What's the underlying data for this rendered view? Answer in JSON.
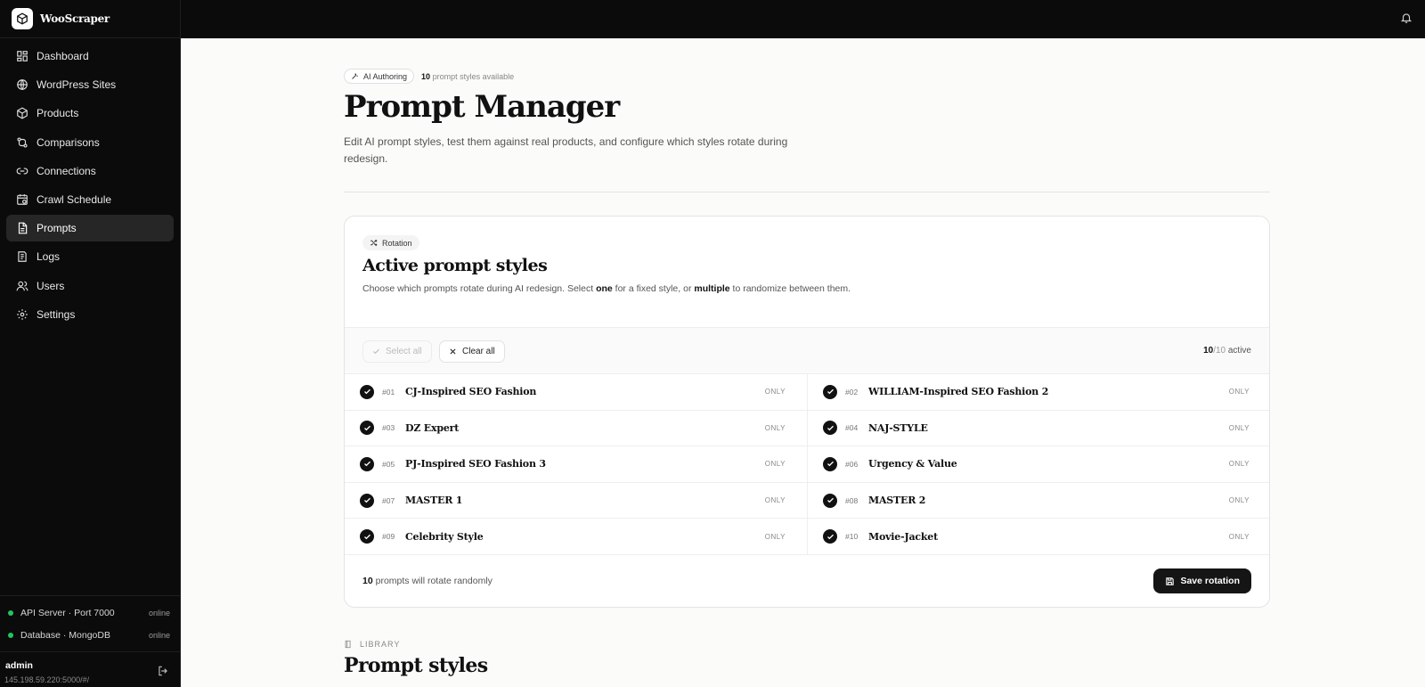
{
  "app": {
    "name": "WooScraper"
  },
  "sidebar": {
    "items": [
      {
        "label": "Dashboard",
        "icon": "grid-icon"
      },
      {
        "label": "WordPress Sites",
        "icon": "globe-icon"
      },
      {
        "label": "Products",
        "icon": "box-icon"
      },
      {
        "label": "Comparisons",
        "icon": "compare-icon"
      },
      {
        "label": "Connections",
        "icon": "link-icon"
      },
      {
        "label": "Crawl Schedule",
        "icon": "calendar-icon"
      },
      {
        "label": "Prompts",
        "icon": "document-icon",
        "active": true
      },
      {
        "label": "Logs",
        "icon": "logs-icon"
      },
      {
        "label": "Users",
        "icon": "users-icon"
      },
      {
        "label": "Settings",
        "icon": "gear-icon"
      }
    ],
    "status": [
      {
        "label": "API Server · Port 7000",
        "value": "online"
      },
      {
        "label": "Database · MongoDB",
        "value": "online"
      }
    ],
    "user": {
      "name": "admin",
      "url": "145.198.59.220:5000/#/"
    }
  },
  "header": {
    "chip": "AI Authoring",
    "count": "10",
    "count_suffix": "prompt styles available",
    "title": "Prompt Manager",
    "description": "Edit AI prompt styles, test them against real products, and configure which styles rotate during redesign."
  },
  "rotation": {
    "chip": "Rotation",
    "title": "Active prompt styles",
    "desc_1": "Choose which prompts rotate during AI redesign. Select ",
    "desc_one": "one",
    "desc_2": " for a fixed style, or ",
    "desc_multiple": "multiple",
    "desc_3": " to randomize between them.",
    "select_all": "Select all",
    "clear_all": "Clear all",
    "active_count": "10",
    "active_total": "/10",
    "active_suffix": "active",
    "only_label": "ONLY",
    "prompts": [
      {
        "num": "#01",
        "name": "CJ-Inspired SEO Fashion",
        "checked": true
      },
      {
        "num": "#02",
        "name": "WILLIAM-Inspired SEO Fashion 2",
        "checked": true
      },
      {
        "num": "#03",
        "name": "DZ Expert",
        "checked": true
      },
      {
        "num": "#04",
        "name": "NAJ-STYLE",
        "checked": true
      },
      {
        "num": "#05",
        "name": "PJ-Inspired SEO Fashion 3",
        "checked": true
      },
      {
        "num": "#06",
        "name": "Urgency & Value",
        "checked": true
      },
      {
        "num": "#07",
        "name": "MASTER 1",
        "checked": true
      },
      {
        "num": "#08",
        "name": "MASTER 2",
        "checked": true
      },
      {
        "num": "#09",
        "name": "Celebrity Style",
        "checked": true
      },
      {
        "num": "#10",
        "name": "Movie-Jacket",
        "checked": true
      }
    ],
    "footer_count": "10",
    "footer_suffix": "prompts will rotate randomly",
    "save_label": "Save rotation"
  },
  "library": {
    "label": "LIBRARY",
    "title": "Prompt styles"
  },
  "colors": {
    "accent": "#111111",
    "online": "#22c55e",
    "sidebar_bg": "#0b0b0b"
  }
}
